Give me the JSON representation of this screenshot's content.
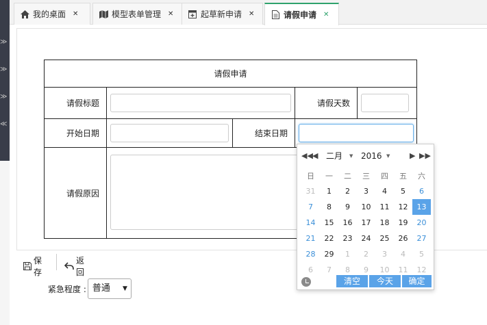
{
  "tabs": [
    {
      "label": "我的桌面",
      "icon": "home-icon",
      "active": false
    },
    {
      "label": "模型表单管理",
      "icon": "map-icon",
      "active": false
    },
    {
      "label": "起草新申请",
      "icon": "calendar-plus-icon",
      "active": false
    },
    {
      "label": "请假申请",
      "icon": "document-icon",
      "active": true
    }
  ],
  "form": {
    "title": "请假申请",
    "leave_title_label": "请假标题",
    "leave_title_value": "",
    "leave_days_label": "请假天数",
    "leave_days_value": "",
    "start_date_label": "开始日期",
    "start_date_value": "",
    "end_date_label": "结束日期",
    "end_date_value": "",
    "reason_label": "请假原因",
    "reason_value": ""
  },
  "datepicker": {
    "month": "二月",
    "year": "2016",
    "weekdays": [
      "日",
      "一",
      "二",
      "三",
      "四",
      "五",
      "六"
    ],
    "weeks": [
      [
        "31",
        "1",
        "2",
        "3",
        "4",
        "5",
        "6"
      ],
      [
        "7",
        "8",
        "9",
        "10",
        "11",
        "12",
        "13"
      ],
      [
        "14",
        "15",
        "16",
        "17",
        "18",
        "19",
        "20"
      ],
      [
        "21",
        "22",
        "23",
        "24",
        "25",
        "26",
        "27"
      ],
      [
        "28",
        "29",
        "1",
        "2",
        "3",
        "4",
        "5"
      ],
      [
        "6",
        "7",
        "8",
        "9",
        "10",
        "11",
        "12"
      ]
    ],
    "selected_day": "13",
    "clear_label": "清空",
    "today_label": "今天",
    "ok_label": "确定",
    "accent_color": "#5aa3e8"
  },
  "toolbar": {
    "save_label": "保存",
    "back_label": "返回"
  },
  "urgency": {
    "label": "紧急程度 :",
    "selected": "普通"
  },
  "colors": {
    "active_tab_accent": "#2ea26c",
    "sidebar_dark": "#393d49"
  }
}
